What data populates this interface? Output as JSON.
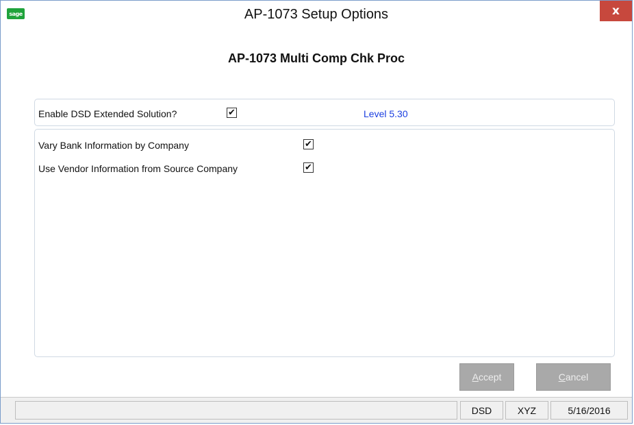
{
  "window": {
    "app_icon_text": "sage",
    "title": "AP-1073 Setup Options",
    "close_label": "x"
  },
  "form": {
    "subtitle": "AP-1073 Multi Comp Chk Proc",
    "enable_dsd": {
      "label": "Enable DSD Extended Solution?",
      "checked": true,
      "mark": "✔"
    },
    "level": "Level 5.30",
    "options": [
      {
        "label": "Vary Bank Information by Company",
        "checked": true,
        "mark": "✔"
      },
      {
        "label": "Use Vendor Information from Source Company",
        "checked": true,
        "mark": "✔"
      }
    ]
  },
  "buttons": {
    "accept_key": "A",
    "accept_rest": "ccept",
    "cancel_key": "C",
    "cancel_rest": "ancel"
  },
  "statusbar": {
    "message": "",
    "cells": [
      "DSD",
      "XYZ",
      "5/16/2016"
    ]
  },
  "colors": {
    "accent_green": "#1fa33b",
    "close_red": "#c7483d",
    "level_blue": "#1a3ee0",
    "button_disabled": "#a9a9a9"
  }
}
